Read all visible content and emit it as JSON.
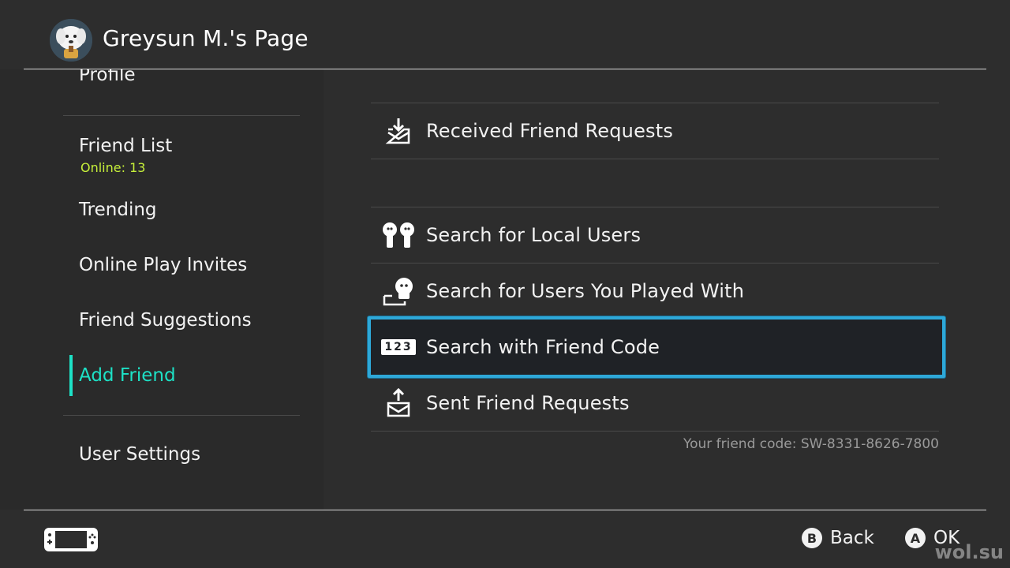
{
  "header": {
    "title": "Greysun M.'s Page"
  },
  "sidebar": {
    "items": [
      {
        "label": "Profile"
      },
      {
        "label": "Friend List",
        "sub": "Online: 13"
      },
      {
        "label": "Trending"
      },
      {
        "label": "Online Play Invites"
      },
      {
        "label": "Friend Suggestions"
      },
      {
        "label": "Add Friend",
        "active": true
      },
      {
        "label": "User Settings"
      }
    ]
  },
  "main": {
    "rows": [
      {
        "label": "Received Friend Requests",
        "icon": "inbox-download-icon"
      },
      {
        "label": "Search for Local Users",
        "icon": "local-users-icon"
      },
      {
        "label": "Search for Users You Played With",
        "icon": "played-with-icon"
      },
      {
        "label": "Search with Friend Code",
        "icon": "friend-code-123-icon",
        "selected": true,
        "icon_text": "123"
      },
      {
        "label": "Sent Friend Requests",
        "icon": "outbox-upload-icon"
      }
    ],
    "friend_code_text": "Your friend code: SW-8331-8626-7800"
  },
  "footer": {
    "back": {
      "key": "B",
      "label": "Back"
    },
    "ok": {
      "key": "A",
      "label": "OK"
    }
  },
  "watermark": "wol.su",
  "colors": {
    "accent_active": "#1de1c6",
    "online_text": "#c6ef3a",
    "selection_border": "#2ea8d8"
  }
}
